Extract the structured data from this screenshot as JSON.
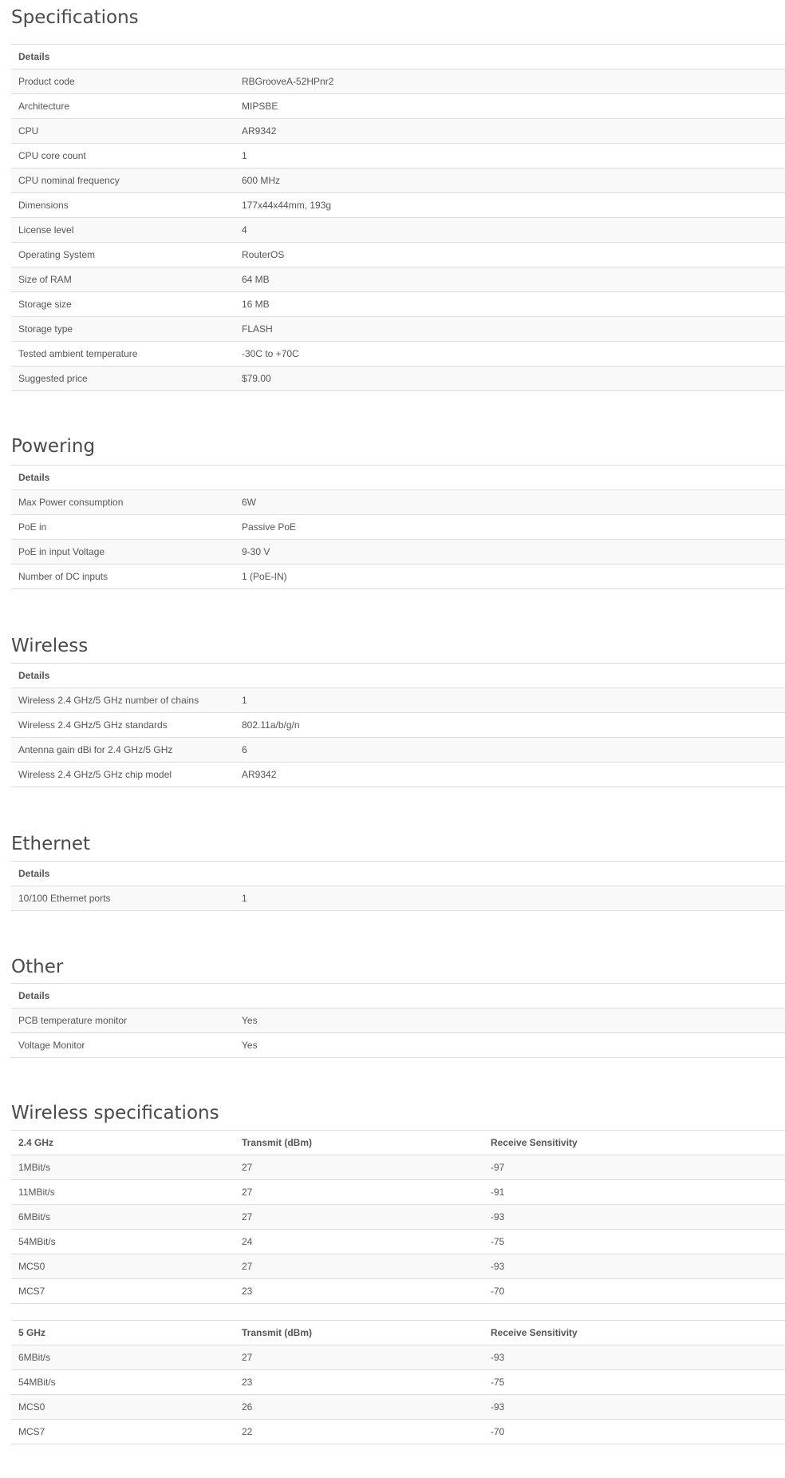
{
  "sections": {
    "specifications": {
      "title": "Specifications",
      "header": "Details",
      "rows": [
        {
          "label": "Product code",
          "value": "RBGrooveA-52HPnr2"
        },
        {
          "label": "Architecture",
          "value": "MIPSBE"
        },
        {
          "label": "CPU",
          "value": "AR9342"
        },
        {
          "label": "CPU core count",
          "value": "1"
        },
        {
          "label": "CPU nominal frequency",
          "value": "600 MHz"
        },
        {
          "label": "Dimensions",
          "value": "177x44x44mm, 193g"
        },
        {
          "label": "License level",
          "value": "4"
        },
        {
          "label": "Operating System",
          "value": "RouterOS"
        },
        {
          "label": "Size of RAM",
          "value": "64 MB"
        },
        {
          "label": "Storage size",
          "value": "16 MB"
        },
        {
          "label": "Storage type",
          "value": "FLASH"
        },
        {
          "label": "Tested ambient temperature",
          "value": "-30C to +70C"
        },
        {
          "label": "Suggested price",
          "value": "$79.00"
        }
      ]
    },
    "powering": {
      "title": "Powering",
      "header": "Details",
      "rows": [
        {
          "label": "Max Power consumption",
          "value": "6W"
        },
        {
          "label": "PoE in",
          "value": "Passive PoE"
        },
        {
          "label": "PoE in input Voltage",
          "value": "9-30 V"
        },
        {
          "label": "Number of DC inputs",
          "value": "1 (PoE-IN)"
        }
      ]
    },
    "wireless": {
      "title": "Wireless",
      "header": "Details",
      "rows": [
        {
          "label": "Wireless 2.4 GHz/5 GHz number of chains",
          "value": "1"
        },
        {
          "label": "Wireless 2.4 GHz/5 GHz standards",
          "value": "802.11a/b/g/n"
        },
        {
          "label": "Antenna gain dBi for 2.4 GHz/5 GHz",
          "value": "6"
        },
        {
          "label": "Wireless 2.4 GHz/5 GHz chip model",
          "value": "AR9342"
        }
      ]
    },
    "ethernet": {
      "title": "Ethernet",
      "header": "Details",
      "rows": [
        {
          "label": "10/100 Ethernet ports",
          "value": "1"
        }
      ]
    },
    "other": {
      "title": "Other",
      "header": "Details",
      "rows": [
        {
          "label": "PCB temperature monitor",
          "value": "Yes"
        },
        {
          "label": "Voltage Monitor",
          "value": "Yes"
        }
      ]
    },
    "wireless_specs": {
      "title": "Wireless specifications",
      "band_24": {
        "headers": [
          "2.4 GHz",
          "Transmit (dBm)",
          "Receive Sensitivity"
        ],
        "rows": [
          [
            "1MBit/s",
            "27",
            "-97"
          ],
          [
            "11MBit/s",
            "27",
            "-91"
          ],
          [
            "6MBit/s",
            "27",
            "-93"
          ],
          [
            "54MBit/s",
            "24",
            "-75"
          ],
          [
            "MCS0",
            "27",
            "-93"
          ],
          [
            "MCS7",
            "23",
            "-70"
          ]
        ]
      },
      "band_5": {
        "headers": [
          "5 GHz",
          "Transmit (dBm)",
          "Receive Sensitivity"
        ],
        "rows": [
          [
            "6MBit/s",
            "27",
            "-93"
          ],
          [
            "54MBit/s",
            "23",
            "-75"
          ],
          [
            "MCS0",
            "26",
            "-93"
          ],
          [
            "MCS7",
            "22",
            "-70"
          ]
        ]
      }
    }
  }
}
